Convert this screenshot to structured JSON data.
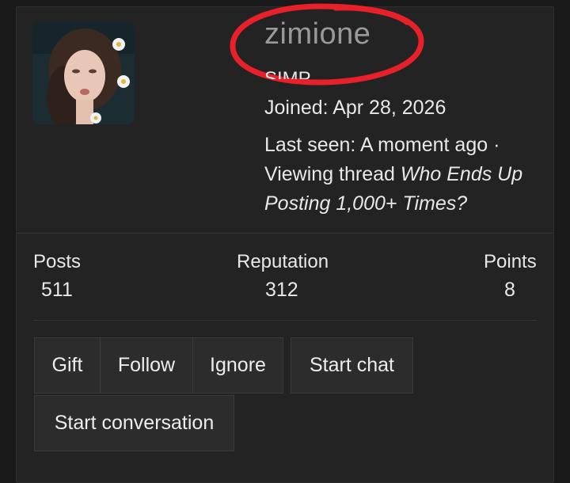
{
  "profile": {
    "username": "zimione",
    "user_title": "SIMP",
    "joined_label": "Joined:",
    "joined_date": "Apr 28, 2026",
    "last_seen_label": "Last seen:",
    "last_seen_value": "A moment ago ·",
    "activity_prefix": "Viewing thread",
    "activity_thread": "Who Ends Up Posting 1,000+ Times?"
  },
  "stats": {
    "posts_label": "Posts",
    "posts_value": "511",
    "reputation_label": "Reputation",
    "reputation_value": "312",
    "points_label": "Points",
    "points_value": "8"
  },
  "actions": {
    "gift": "Gift",
    "follow": "Follow",
    "ignore": "Ignore",
    "start_chat": "Start chat",
    "start_conversation": "Start conversation"
  },
  "colors": {
    "annotation": "#e8202a",
    "background": "#232323"
  }
}
